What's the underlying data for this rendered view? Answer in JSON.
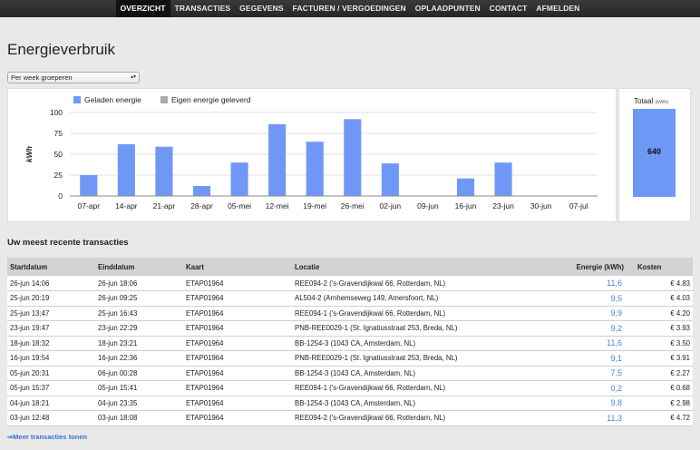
{
  "nav": {
    "items": [
      {
        "label": "OVERZICHT",
        "active": true
      },
      {
        "label": "TRANSACTIES"
      },
      {
        "label": "GEGEVENS"
      },
      {
        "label": "FACTUREN / VERGOEDINGEN"
      },
      {
        "label": "OPLAADPUNTEN"
      },
      {
        "label": "CONTACT"
      },
      {
        "label": "AFMELDEN"
      }
    ]
  },
  "page": {
    "title": "Energieverbruik"
  },
  "grouping": {
    "selected": "Per week groeperen"
  },
  "chart_data": {
    "type": "bar",
    "ylabel": "kWh",
    "ylim": [
      0,
      100
    ],
    "yticks": [
      0,
      25,
      50,
      75,
      100
    ],
    "legend_position": "top-left",
    "grid": true,
    "categories": [
      "07-apr",
      "14-apr",
      "21-apr",
      "28-apr",
      "05-mei",
      "12-mei",
      "19-mei",
      "26-mei",
      "02-jun",
      "09-jun",
      "16-jun",
      "23-jun",
      "30-jun",
      "07-jul"
    ],
    "bar_positions": [
      0,
      1,
      2,
      3,
      4,
      5,
      6,
      7,
      8,
      9,
      10,
      11
    ],
    "series": [
      {
        "name": "Geladen energie",
        "color": "#6f98f6",
        "values": [
          25,
          62,
          59,
          12,
          40,
          86,
          65,
          92,
          39,
          0,
          21,
          40
        ]
      },
      {
        "name": "Eigen energie geleverd",
        "color": "#a9a9a9",
        "values": [
          0,
          0,
          0,
          0,
          0,
          0,
          0,
          0,
          0,
          0,
          0,
          0
        ]
      }
    ]
  },
  "total": {
    "label": "Totaal",
    "unit": "(kWh)",
    "value": "640",
    "color": "#6f98f6"
  },
  "transactions": {
    "title": "Uw meest recente transacties",
    "headers": {
      "start": "Startdatum",
      "end": "Einddatum",
      "card": "Kaart",
      "location": "Locatie",
      "energy": "Energie (kWh)",
      "cost": "Kosten"
    },
    "rows": [
      {
        "start": "26-jun 14:06",
        "end": "26-jun 18:06",
        "card": "ETAP01964",
        "location": "REE094-2 ('s-Gravendijkwal 66, Rotterdam, NL)",
        "energy": "11,6",
        "cost": "€ 4.83"
      },
      {
        "start": "25-jun 20:19",
        "end": "26-jun 09:25",
        "card": "ETAP01964",
        "location": "AL504-2 (Arnhemseweg 149, Amersfoort, NL)",
        "energy": "9,5",
        "cost": "€ 4.03"
      },
      {
        "start": "25-jun 13:47",
        "end": "25-jun 16:43",
        "card": "ETAP01964",
        "location": "REE094-1 ('s-Gravendijkwal 66, Rotterdam, NL)",
        "energy": "9,9",
        "cost": "€ 4.20"
      },
      {
        "start": "23-jun 19:47",
        "end": "23-jun 22:29",
        "card": "ETAP01964",
        "location": "PNB-REE0029-1 (St. Ignatiusstraat 253, Breda, NL)",
        "energy": "9,2",
        "cost": "€ 3.93"
      },
      {
        "start": "18-jun 18:32",
        "end": "18-jun 23:21",
        "card": "ETAP01964",
        "location": "BB-1254-3 (1043 CA, Amsterdam, NL)",
        "energy": "11,6",
        "cost": "€ 3.50"
      },
      {
        "start": "16-jun 19:54",
        "end": "16-jun 22:36",
        "card": "ETAP01964",
        "location": "PNB-REE0029-1 (St. Ignatiusstraat 253, Breda, NL)",
        "energy": "9,1",
        "cost": "€ 3.91"
      },
      {
        "start": "05-jun 20:31",
        "end": "06-jun 00:28",
        "card": "ETAP01964",
        "location": "BB-1254-3 (1043 CA, Amsterdam, NL)",
        "energy": "7,5",
        "cost": "€ 2.27"
      },
      {
        "start": "05-jun 15:37",
        "end": "05-jun 15:41",
        "card": "ETAP01964",
        "location": "REE094-1 ('s-Gravendijkwal 66, Rotterdam, NL)",
        "energy": "0,2",
        "cost": "€ 0.68"
      },
      {
        "start": "04-jun 18:21",
        "end": "04-jun 23:35",
        "card": "ETAP01964",
        "location": "BB-1254-3 (1043 CA, Amsterdam, NL)",
        "energy": "9,8",
        "cost": "€ 2.98"
      },
      {
        "start": "03-jun 12:48",
        "end": "03-jun 18:08",
        "card": "ETAP01964",
        "location": "REE094-2 ('s-Gravendijkwal 66, Rotterdam, NL)",
        "energy": "11,3",
        "cost": "€ 4.72"
      }
    ],
    "more_link": "⇒Meer transacties tonen"
  }
}
